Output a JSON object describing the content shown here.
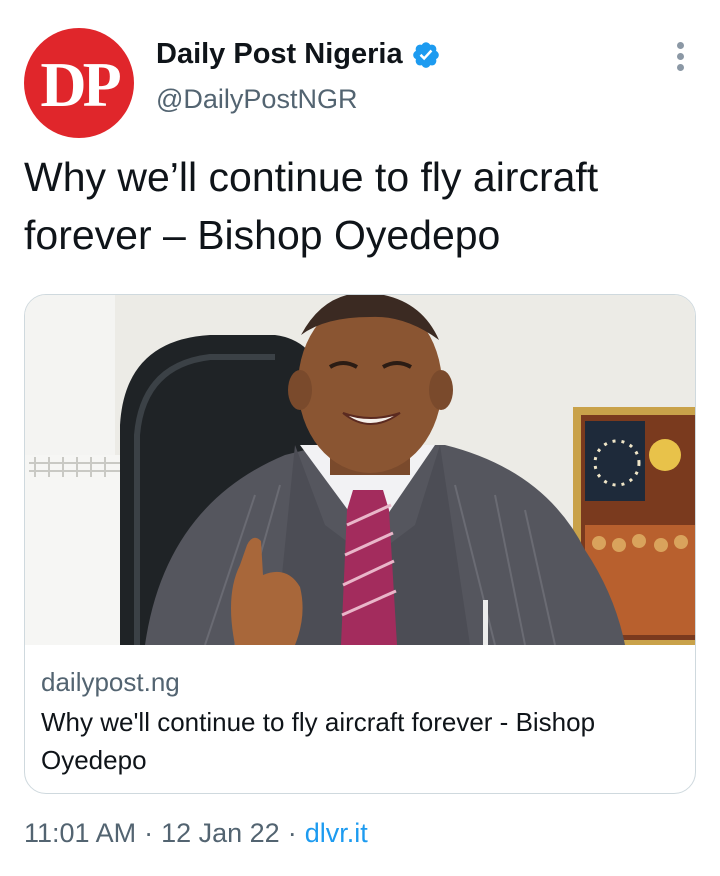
{
  "author": {
    "avatar_text": "DP",
    "display_name": "Daily Post Nigeria",
    "handle": "@DailyPostNGR",
    "verified": true,
    "verified_icon": "verified-badge-icon",
    "avatar_color": "#e0262b"
  },
  "tweet": {
    "text": "Why we’ll continue to fly aircraft forever – Bishop Oyedepo"
  },
  "card": {
    "domain": "dailypost.ng",
    "title": "Why we'll continue to fly aircraft forever - Bishop Oyedepo"
  },
  "meta": {
    "time": "11:01 AM",
    "separator": "·",
    "date": "12 Jan 22",
    "source": "dlvr.it"
  },
  "colors": {
    "link": "#1d9bf0",
    "secondary_text": "#536471",
    "primary_text": "#0f1419",
    "border": "#cfd9de"
  }
}
